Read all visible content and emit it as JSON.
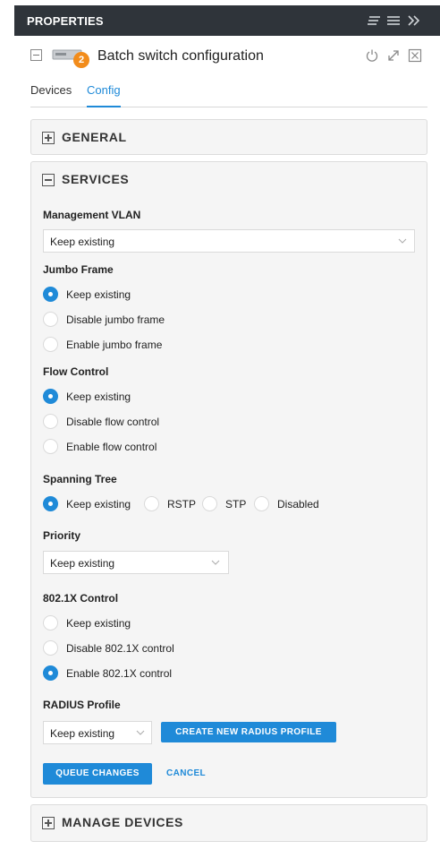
{
  "panel": {
    "title": "PROPERTIES"
  },
  "device": {
    "badge_count": "2",
    "name": "Batch switch configuration"
  },
  "tabs": [
    {
      "label": "Devices",
      "active": false
    },
    {
      "label": "Config",
      "active": true
    }
  ],
  "sections": {
    "general": {
      "label": "GENERAL",
      "expanded": false
    },
    "services": {
      "label": "SERVICES",
      "expanded": true
    },
    "manage": {
      "label": "MANAGE DEVICES",
      "expanded": false
    }
  },
  "services": {
    "management_vlan": {
      "label": "Management VLAN",
      "value": "Keep existing"
    },
    "jumbo_frame": {
      "label": "Jumbo Frame",
      "options": [
        "Keep existing",
        "Disable jumbo frame",
        "Enable jumbo frame"
      ],
      "selected": 0
    },
    "flow_control": {
      "label": "Flow Control",
      "options": [
        "Keep existing",
        "Disable flow control",
        "Enable flow control"
      ],
      "selected": 0
    },
    "spanning_tree": {
      "label": "Spanning Tree",
      "options": [
        "Keep existing",
        "RSTP",
        "STP",
        "Disabled"
      ],
      "selected": 0
    },
    "priority": {
      "label": "Priority",
      "value": "Keep existing"
    },
    "dot1x": {
      "label": "802.1X Control",
      "options": [
        "Keep existing",
        "Disable 802.1X control",
        "Enable 802.1X control"
      ],
      "selected": 2
    },
    "radius": {
      "label": "RADIUS Profile",
      "value": "Keep existing",
      "create_label": "CREATE NEW RADIUS PROFILE"
    },
    "actions": {
      "queue_label": "QUEUE CHANGES",
      "cancel_label": "CANCEL"
    }
  },
  "colors": {
    "accent": "#1f8ad8",
    "header_bg": "#2f343a",
    "badge": "#f28c1b",
    "section_bg": "#f5f5f5"
  },
  "icons": [
    "sort-icon",
    "menu-icon",
    "collapse-panel-icon",
    "minus-box-icon",
    "switch-device-icon",
    "power-icon",
    "expand-icon",
    "close-box-icon",
    "plus-box-icon",
    "chevron-down-icon"
  ]
}
